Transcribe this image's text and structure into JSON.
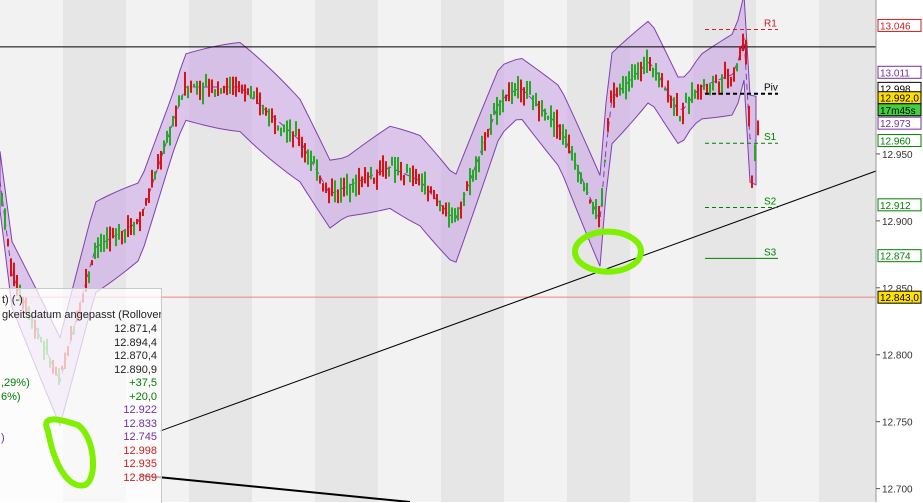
{
  "colors": {
    "background": "#ffffff",
    "band_light": "#f2f2f2",
    "band_dark": "#e6e6e6",
    "bollinger_fill": "#c8a0e6",
    "bollinger_line": "#8040b0",
    "up_bar": "#22aa22",
    "down_bar": "#dd1111",
    "highlight": "#7ff000",
    "r_level": "#cc2020",
    "s_level": "#008000"
  },
  "chart_data": {
    "type": "bar",
    "title": "",
    "ylim": [
      12.69,
      13.065
    ],
    "y_ticks": [
      12.7,
      12.75,
      12.8,
      12.85,
      12.9,
      12.95
    ],
    "y_tick_labels": [
      "12.700",
      "12.750",
      "12.800",
      "12.850",
      "12.900",
      "12.950"
    ],
    "grid": false,
    "horizontal_line_value": 13.03,
    "current_price_line_value": 12.843,
    "pivot_levels": [
      {
        "name": "R1",
        "value": 13.043,
        "style": "dashed",
        "color": "#cc2020"
      },
      {
        "name": "Piv",
        "value": 12.995,
        "style": "dashed",
        "color": "#000000"
      },
      {
        "name": "S1",
        "value": 12.958,
        "style": "dashed",
        "color": "#008000"
      },
      {
        "name": "S2",
        "value": 12.91,
        "style": "dashed",
        "color": "#008000"
      },
      {
        "name": "S3",
        "value": 12.872,
        "style": "solid",
        "color": "#008000"
      }
    ],
    "price_axis_labels": [
      {
        "text": "13.046",
        "value": 13.046,
        "color": "#cc2020"
      },
      {
        "text": "13.011",
        "value": 13.011,
        "color": "#7030a0"
      },
      {
        "text": "12.998",
        "value": 12.999,
        "color": "#000000"
      },
      {
        "text": "12.992,0",
        "value": 12.992,
        "color": "#000000",
        "bg": "#ffe000"
      },
      {
        "text": "17m45s",
        "value": 12.983,
        "color": "#000000",
        "bg": "#40d040"
      },
      {
        "text": "12.973",
        "value": 12.973,
        "color": "#7030a0"
      },
      {
        "text": "12.960",
        "value": 12.96,
        "color": "#008000"
      },
      {
        "text": "12.912",
        "value": 12.912,
        "color": "#008000"
      },
      {
        "text": "12.874",
        "value": 12.874,
        "color": "#008000"
      },
      {
        "text": "12.843,0",
        "value": 12.843,
        "color": "#000000",
        "bg": "#ffe000"
      }
    ],
    "trendlines": [
      {
        "x1": 160,
        "y1": 12.743,
        "x2": 923,
        "y2": 12.95
      },
      {
        "x1": 140,
        "y1": 12.71,
        "x2": 410,
        "y2": 12.69
      }
    ]
  },
  "info_panel": {
    "title": "t) (-)",
    "subtitle": "gkeitsdatum angepasst (Rollover)",
    "rows": [
      {
        "label": "",
        "value": "12.871,4",
        "color": "#222222"
      },
      {
        "label": "",
        "value": "12.894,4",
        "color": "#222222"
      },
      {
        "label": "",
        "value": "12.870,4",
        "color": "#222222"
      },
      {
        "label": "",
        "value": "12.890,9",
        "color": "#222222"
      },
      {
        "label": ",29%)",
        "value": "+37,5",
        "color": "#008000"
      },
      {
        "label": "6%)",
        "value": "+20,0",
        "color": "#008000"
      },
      {
        "label": "",
        "value": "12.922",
        "color": "#7030a0"
      },
      {
        "label": "",
        "value": "12.833",
        "color": "#7030a0"
      },
      {
        "label": "",
        "value": "12.745",
        "color": "#7030a0"
      },
      {
        "label": "",
        "value": "12.998",
        "color": "#cc2020"
      },
      {
        "label": "",
        "value": "12.935",
        "color": "#cc2020"
      },
      {
        "label": "",
        "value": "12.869",
        "color": "#cc2020"
      }
    ],
    "side_label": ")"
  }
}
